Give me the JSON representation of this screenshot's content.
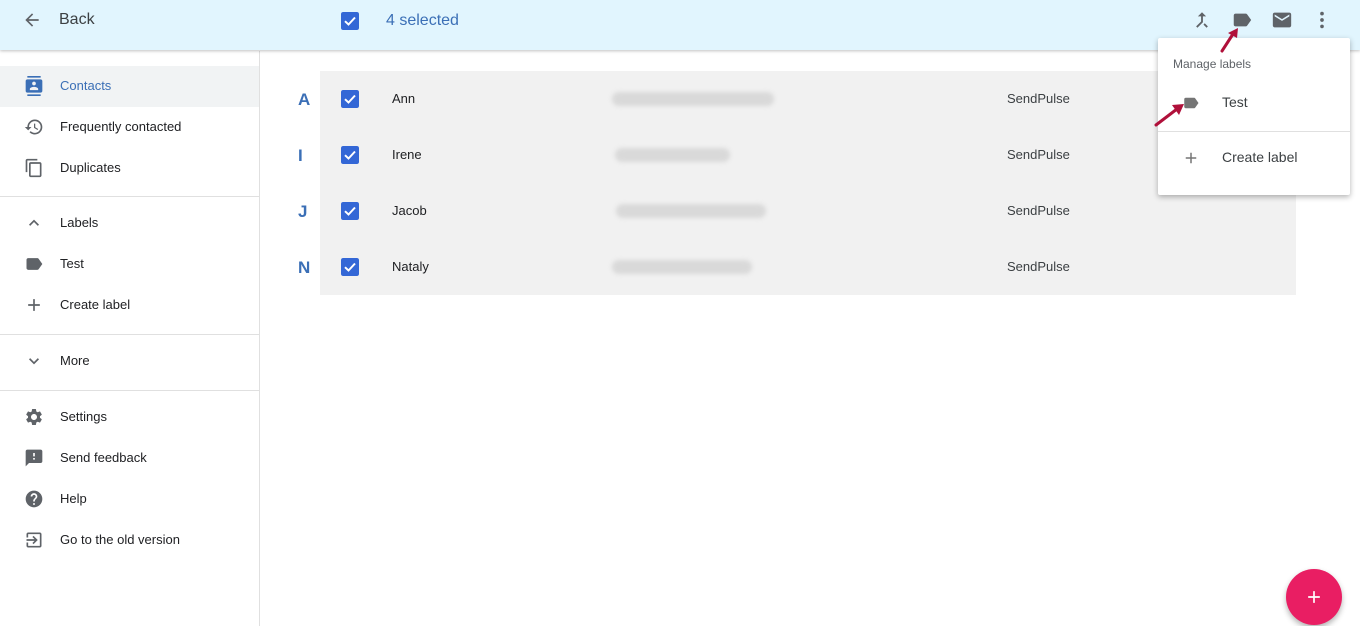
{
  "topbar": {
    "back_label": "Back",
    "selected_label": "4 selected",
    "icons": [
      "merge-icon",
      "label-icon",
      "mail-icon",
      "more-vert-icon"
    ]
  },
  "sidebar": {
    "items": [
      {
        "label": "Contacts",
        "icon": "contacts-icon",
        "active": true
      },
      {
        "label": "Frequently contacted",
        "icon": "history-icon"
      },
      {
        "label": "Duplicates",
        "icon": "duplicates-icon"
      },
      {
        "label": "Labels",
        "icon": "chevron-up-icon"
      },
      {
        "label": "Test",
        "icon": "label-icon"
      },
      {
        "label": "Create label",
        "icon": "plus-icon"
      },
      {
        "label": "More",
        "icon": "chevron-down-icon"
      },
      {
        "label": "Settings",
        "icon": "gear-icon"
      },
      {
        "label": "Send feedback",
        "icon": "feedback-icon"
      },
      {
        "label": "Help",
        "icon": "help-icon"
      },
      {
        "label": "Go to the old version",
        "icon": "exit-icon"
      }
    ]
  },
  "contacts": [
    {
      "letter": "A",
      "name": "Ann",
      "company": "SendPulse",
      "checked": true
    },
    {
      "letter": "I",
      "name": "Irene",
      "company": "SendPulse",
      "checked": true
    },
    {
      "letter": "J",
      "name": "Jacob",
      "company": "SendPulse",
      "checked": true
    },
    {
      "letter": "N",
      "name": "Nataly",
      "company": "SendPulse",
      "checked": true
    }
  ],
  "menu": {
    "title": "Manage labels",
    "items": [
      {
        "label": "Test",
        "icon": "label-icon"
      },
      {
        "label": "Create label",
        "icon": "plus-icon"
      }
    ]
  },
  "colors": {
    "accent": "#3b6fb6",
    "topbar": "#e1f5fe",
    "fab": "#e91e63",
    "annotation_arrow": "#b0103a"
  }
}
